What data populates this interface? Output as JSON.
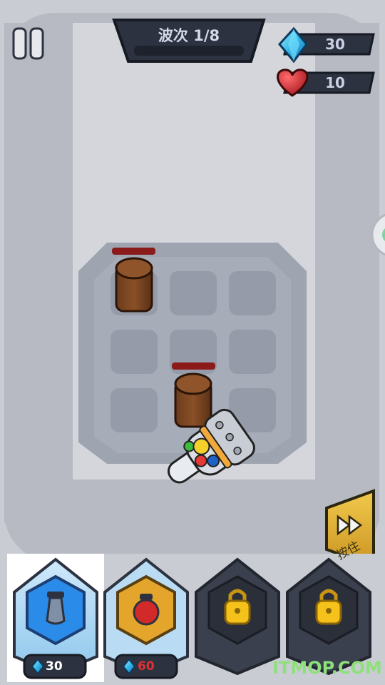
{
  "hud": {
    "wave_label": "波次 1/8",
    "gems": "30",
    "lives": "10",
    "pause_icon": "pause-icon",
    "gem_icon": "diamond-gem-icon",
    "heart_icon": "heart-icon"
  },
  "speed_button": {
    "label": "按住",
    "icon": "fast-forward-icon"
  },
  "tower_cards": [
    {
      "type": "blue-bomb-tower",
      "cost": "30",
      "state": "selected",
      "icon": "bomb-icon",
      "cost_color": "#ffffff"
    },
    {
      "type": "red-bomb-tower",
      "cost": "60",
      "state": "available",
      "icon": "red-bomb-icon",
      "cost_color": "#e03131"
    },
    {
      "type": "locked-tower",
      "state": "locked",
      "icon": "padlock-icon"
    },
    {
      "type": "locked-tower",
      "state": "locked",
      "icon": "padlock-icon"
    }
  ],
  "watermark": "ITMOP.COM",
  "colors": {
    "background": "#c9ccd3",
    "panel_dark": "#2c3240",
    "gem_blue": "#33b6e8",
    "health_red": "#8b1a1a",
    "speed_gold": "#d9ad2e"
  }
}
